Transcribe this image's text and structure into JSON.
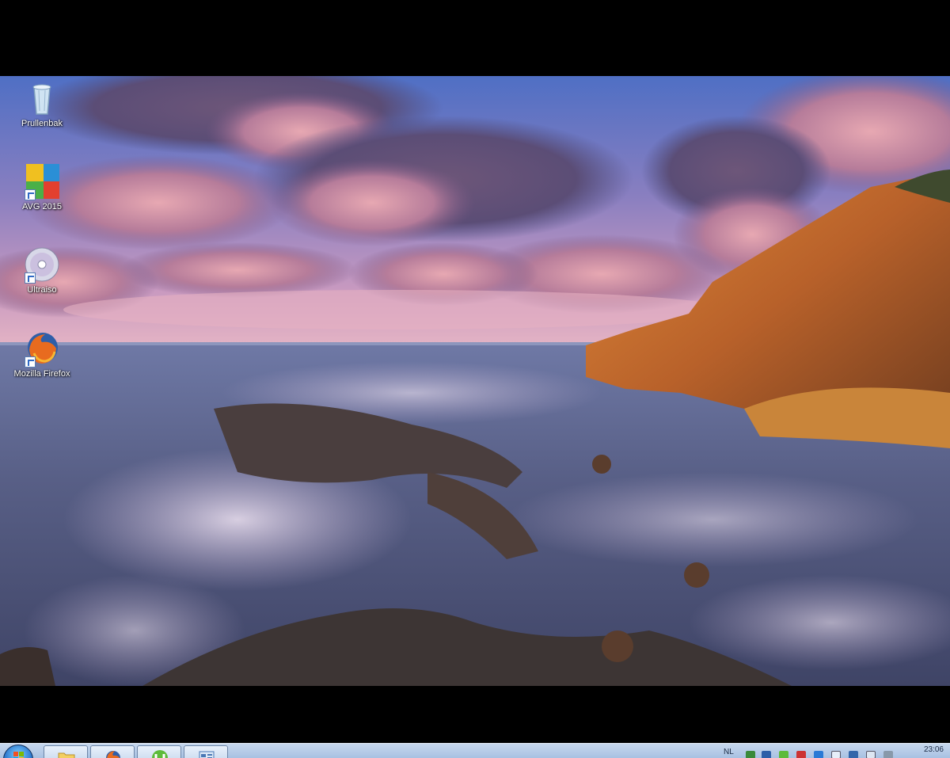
{
  "desktop": {
    "icons": [
      {
        "label": "Prullenbak",
        "icon": "recycle-bin-icon"
      },
      {
        "label": "AVG 2015",
        "icon": "avg-icon"
      },
      {
        "label": "Ultraiso",
        "icon": "disc-icon"
      },
      {
        "label": "Mozilla Firefox",
        "icon": "firefox-icon"
      }
    ],
    "wallpaper": "coastal-sunset"
  },
  "taskbar": {
    "pinned": [
      {
        "icon": "folder-icon"
      },
      {
        "icon": "firefox-icon"
      },
      {
        "icon": "utorrent-icon"
      },
      {
        "icon": "control-panel-icon"
      }
    ],
    "tray": {
      "language": "NL",
      "time": "23:06"
    }
  },
  "colors": {
    "taskbar_top": "#c7d8ee",
    "taskbar_bottom": "#a8c1e2",
    "sky_top": "#5e73b8",
    "sea": "#5f6b92"
  }
}
